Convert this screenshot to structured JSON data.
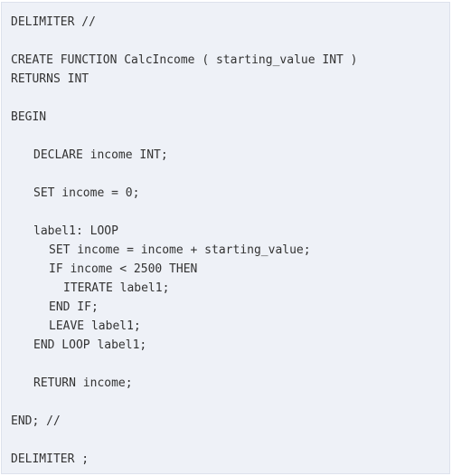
{
  "code": {
    "lines": [
      {
        "indent": 0,
        "text": "DELIMITER //"
      },
      {
        "indent": 0,
        "text": "CREATE FUNCTION CalcIncome ( starting_value INT )"
      },
      {
        "indent": 0,
        "text": "RETURNS INT"
      },
      {
        "indent": 0,
        "text": "BEGIN"
      },
      {
        "indent": 1,
        "text": "DECLARE income INT;"
      },
      {
        "indent": 1,
        "text": "SET income = 0;"
      },
      {
        "indent": 1,
        "text": "label1: LOOP"
      },
      {
        "indent": 2,
        "text": "SET income = income + starting_value;"
      },
      {
        "indent": 2,
        "text": "IF income < 2500 THEN"
      },
      {
        "indent": 3,
        "text": "ITERATE label1;"
      },
      {
        "indent": 2,
        "text": "END IF;"
      },
      {
        "indent": 2,
        "text": "LEAVE label1;"
      },
      {
        "indent": 1,
        "text": "END LOOP label1;"
      },
      {
        "indent": 1,
        "text": "RETURN income;"
      },
      {
        "indent": 0,
        "text": "END; //"
      },
      {
        "indent": 0,
        "text": "DELIMITER ;"
      }
    ]
  }
}
